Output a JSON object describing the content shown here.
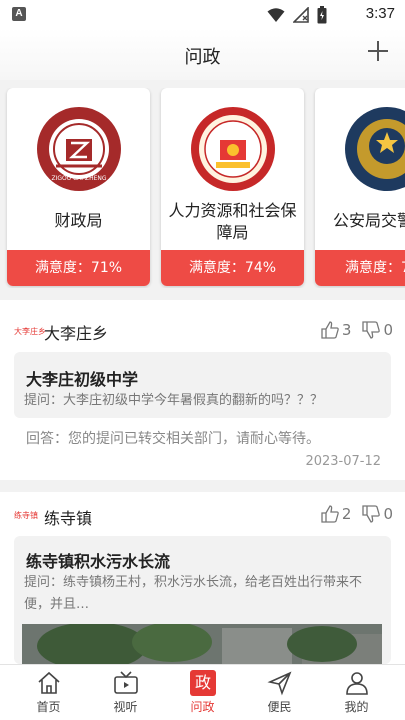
{
  "status_bar": {
    "app_badge": "A",
    "time": "3:37"
  },
  "header": {
    "title": "问政"
  },
  "departments": [
    {
      "name": "财政局",
      "satisfaction": "满意度：71%",
      "logo_text": "ZIGOU CAI ZHENG"
    },
    {
      "name": "人力资源和社会保障局",
      "satisfaction": "满意度：74%"
    },
    {
      "name": "公安局交警",
      "satisfaction": "满意度：7"
    }
  ],
  "posts": [
    {
      "town_badge": "大李庄乡",
      "town": "大李庄乡",
      "likes": "3",
      "dislikes": "0",
      "question_title": "大李庄初级中学",
      "question_text": "提问：大李庄初级中学今年暑假真的翻新的吗？？？",
      "answer": "回答：您的提问已转交相关部门，请耐心等待。",
      "date": "2023-07-12"
    },
    {
      "town_badge": "练寺镇",
      "town": "练寺镇",
      "likes": "2",
      "dislikes": "0",
      "question_title": "练寺镇积水污水长流",
      "question_text": "提问：练寺镇杨王村，积水污水长流，给老百姓出行带来不便，并且…"
    }
  ],
  "tabbar": {
    "items": [
      {
        "label": "首页"
      },
      {
        "label": "视听"
      },
      {
        "label": "问政",
        "icon_text": "政"
      },
      {
        "label": "便民"
      },
      {
        "label": "我的"
      }
    ]
  },
  "colors": {
    "accent": "#ee4b45",
    "active_tab": "#e53935"
  }
}
